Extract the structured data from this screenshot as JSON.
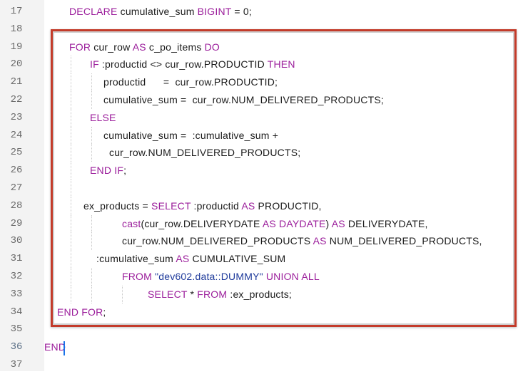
{
  "editor": {
    "lines": [
      {
        "n": "17",
        "indent": 97,
        "tokens": [
          {
            "t": "DECLARE",
            "c": "kw"
          },
          {
            "t": " cumulative_sum ",
            "c": ""
          },
          {
            "t": "BIGINT",
            "c": "kw"
          },
          {
            "t": " = 0;",
            "c": ""
          }
        ]
      },
      {
        "n": "18",
        "indent": 97,
        "tokens": []
      },
      {
        "n": "19",
        "indent": 97,
        "tokens": [
          {
            "t": "FOR",
            "c": "kw"
          },
          {
            "t": " cur_row ",
            "c": ""
          },
          {
            "t": "AS",
            "c": "kw"
          },
          {
            "t": " c_po_items ",
            "c": ""
          },
          {
            "t": "DO",
            "c": "kw"
          }
        ]
      },
      {
        "n": "20",
        "indent": 126,
        "tokens": [
          {
            "t": "IF",
            "c": "kw"
          },
          {
            "t": " :productid <> cur_row.PRODUCTID ",
            "c": ""
          },
          {
            "t": "THEN",
            "c": "kw"
          }
        ]
      },
      {
        "n": "21",
        "indent": 145,
        "tokens": [
          {
            "t": "productid      =  cur_row.PRODUCTID;",
            "c": ""
          }
        ]
      },
      {
        "n": "22",
        "indent": 145,
        "tokens": [
          {
            "t": "cumulative_sum =  cur_row.NUM_DELIVERED_PRODUCTS;",
            "c": ""
          }
        ]
      },
      {
        "n": "23",
        "indent": 126,
        "tokens": [
          {
            "t": "ELSE",
            "c": "kw"
          }
        ]
      },
      {
        "n": "24",
        "indent": 145,
        "tokens": [
          {
            "t": "cumulative_sum =  :cumulative_sum +",
            "c": ""
          }
        ]
      },
      {
        "n": "25",
        "indent": 153,
        "tokens": [
          {
            "t": "cur_row.NUM_DELIVERED_PRODUCTS;",
            "c": ""
          }
        ]
      },
      {
        "n": "26",
        "indent": 126,
        "tokens": [
          {
            "t": "END",
            "c": "kw"
          },
          {
            "t": " ",
            "c": ""
          },
          {
            "t": "IF",
            "c": "kw"
          },
          {
            "t": ";",
            "c": ""
          }
        ]
      },
      {
        "n": "27",
        "indent": 126,
        "tokens": []
      },
      {
        "n": "28",
        "indent": 117,
        "tokens": [
          {
            "t": "ex_products = ",
            "c": ""
          },
          {
            "t": "SELECT",
            "c": "kw"
          },
          {
            "t": " :productid ",
            "c": ""
          },
          {
            "t": "AS",
            "c": "kw"
          },
          {
            "t": " PRODUCTID,",
            "c": ""
          }
        ]
      },
      {
        "n": "29",
        "indent": 171,
        "tokens": [
          {
            "t": "cast",
            "c": "kw"
          },
          {
            "t": "(cur_row.DELIVERYDATE ",
            "c": ""
          },
          {
            "t": "AS",
            "c": "kw"
          },
          {
            "t": " ",
            "c": ""
          },
          {
            "t": "DAYDATE",
            "c": "kw"
          },
          {
            "t": ") ",
            "c": ""
          },
          {
            "t": "AS",
            "c": "kw"
          },
          {
            "t": " DELIVERYDATE,",
            "c": ""
          }
        ]
      },
      {
        "n": "30",
        "indent": 171,
        "tokens": [
          {
            "t": "cur_row.NUM_DELIVERED_PRODUCTS ",
            "c": ""
          },
          {
            "t": "AS",
            "c": "kw"
          },
          {
            "t": " NUM_DELIVERED_PRODUCTS,",
            "c": ""
          }
        ]
      },
      {
        "n": "31",
        "indent": 135,
        "tokens": [
          {
            "t": ":cumulative_sum ",
            "c": ""
          },
          {
            "t": "AS",
            "c": "kw"
          },
          {
            "t": " CUMULATIVE_SUM",
            "c": ""
          }
        ]
      },
      {
        "n": "32",
        "indent": 171,
        "tokens": [
          {
            "t": "FROM",
            "c": "kw"
          },
          {
            "t": " ",
            "c": ""
          },
          {
            "t": "\"dev602.data::DUMMY\"",
            "c": "str"
          },
          {
            "t": " ",
            "c": ""
          },
          {
            "t": "UNION",
            "c": "kw"
          },
          {
            "t": " ",
            "c": ""
          },
          {
            "t": "ALL",
            "c": "kw"
          }
        ]
      },
      {
        "n": "33",
        "indent": 207,
        "tokens": [
          {
            "t": "SELECT",
            "c": "kw"
          },
          {
            "t": " * ",
            "c": ""
          },
          {
            "t": "FROM",
            "c": "kw"
          },
          {
            "t": " :ex_products;",
            "c": ""
          }
        ]
      },
      {
        "n": "34",
        "indent": 80,
        "tokens": [
          {
            "t": "END",
            "c": "kw"
          },
          {
            "t": " ",
            "c": ""
          },
          {
            "t": "FOR",
            "c": "kw"
          },
          {
            "t": ";",
            "c": ""
          }
        ]
      },
      {
        "n": "35",
        "indent": 80,
        "tokens": []
      },
      {
        "n": "36",
        "indent": 62,
        "active": true,
        "tokens": [
          {
            "t": "END",
            "c": "kw"
          }
        ]
      },
      {
        "n": "37",
        "indent": 62,
        "tokens": []
      }
    ],
    "colors": {
      "keyword": "#9b1d9b",
      "string": "#1e3a9b",
      "highlight_border": "#c33b2a",
      "cursor": "#1a73e8",
      "gutter": "#f3f3f3"
    }
  }
}
